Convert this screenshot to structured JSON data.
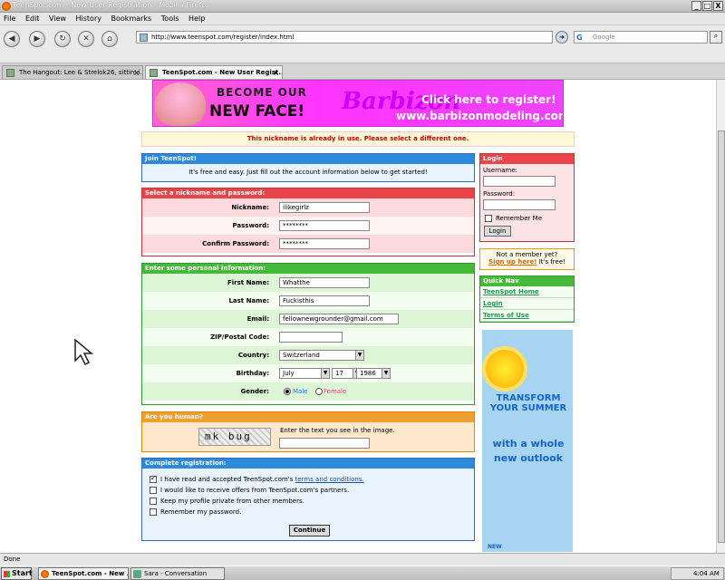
{
  "window": {
    "title": "TeenSpot.com - New User Registration - Mozilla Firefox",
    "controls": [
      "_",
      "□",
      "X"
    ]
  },
  "menu": [
    "File",
    "Edit",
    "View",
    "History",
    "Bookmarks",
    "Tools",
    "Help"
  ],
  "navigation": {
    "url": "http://www.teenspot.com/register/index.html",
    "search_placeholder": "Google"
  },
  "tabs": [
    {
      "label": "The Hangout: Lee & Strelok26, sittin' i...",
      "active": false
    },
    {
      "label": "TeenSpot.com - New User Regist...",
      "active": true
    }
  ],
  "banner": {
    "line1": "BECOME OUR",
    "line2": "NEW FACE!",
    "logo": "Barbizon",
    "cta": "Click here to register!",
    "site": "www.barbizonmodeling.com"
  },
  "error_message": "This nickname is already in use. Please select a different one.",
  "join": {
    "title": "Join TeenSpot!",
    "text": "It's free and easy. Just fill out the account information below to get started!"
  },
  "nickname_section": {
    "title": "Select a nickname and password:",
    "nickname_label": "Nickname:",
    "nickname_value": "ilikegirlz",
    "password_label": "Password:",
    "password_value": "********",
    "confirm_label": "Confirm Password:",
    "confirm_value": "********"
  },
  "personal_section": {
    "title": "Enter some personal information:",
    "first_name_label": "First Name:",
    "first_name_value": "Whatthe",
    "last_name_label": "Last Name:",
    "last_name_value": "Fuckisthis",
    "email_label": "Email:",
    "email_value": "fellownewgrounder@gmail.com",
    "zip_label": "ZIP/Postal Code:",
    "zip_value": "",
    "country_label": "Country:",
    "country_value": "Switzerland",
    "birthday_label": "Birthday:",
    "birth_month": "July",
    "birth_day": "17",
    "birth_year": "1986",
    "gender_label": "Gender:",
    "gender_male": "Male",
    "gender_female": "Female",
    "gender_selected": "Male"
  },
  "human_section": {
    "title": "Are you human?",
    "captcha_text": "mk bug",
    "instruction": "Enter the text you see in the image.",
    "answer_value": ""
  },
  "complete_section": {
    "title": "Complete registration:",
    "terms_prefix": "I have read and accepted TeenSpot.com's",
    "terms_link": "terms and conditions.",
    "terms_checked": true,
    "offers": "I would like to receive offers from TeenSpot.com's partners.",
    "private": "Keep my profile private from other members.",
    "remember": "Remember my password.",
    "continue_label": "Continue"
  },
  "login": {
    "title": "Login",
    "username_label": "Username:",
    "password_label": "Password:",
    "remember_label": "Remember Me",
    "button": "Login"
  },
  "member_box": {
    "line1": "Not a member yet?",
    "signup_link": "Sign up here!",
    "free": "It's free!"
  },
  "quick_nav": {
    "title": "Quick Nav",
    "items": [
      "TeenSpot Home",
      "Login",
      "Terms of Use"
    ]
  },
  "side_ad": {
    "line1": "TRANSFORM YOUR SUMMER",
    "line2": "with a whole new outlook",
    "footer": "NEW"
  },
  "status": "Done",
  "taskbar": {
    "start": "Start",
    "items": [
      "TeenSpot.com - New ...",
      "Sara - Conversation"
    ],
    "time": "4:04 AM"
  }
}
